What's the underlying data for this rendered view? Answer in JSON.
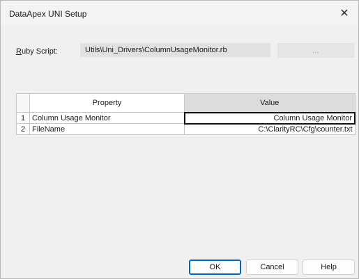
{
  "window": {
    "title": "DataApex UNI Setup",
    "close_glyph": "✕"
  },
  "script": {
    "label_first": "R",
    "label_rest": "uby Script:",
    "value": "Utils\\Uni_Drivers\\ColumnUsageMonitor.rb",
    "browse_label": "..."
  },
  "grid": {
    "headers": {
      "property": "Property",
      "value": "Value"
    },
    "rows": [
      {
        "num": "1",
        "property": "Column Usage Monitor",
        "value": "Column Usage Monitor"
      },
      {
        "num": "2",
        "property": "FileName",
        "value": "C:\\ClarityRC\\Cfg\\counter.txt"
      }
    ]
  },
  "buttons": {
    "ok": "OK",
    "cancel": "Cancel",
    "help": "Help"
  },
  "colors": {
    "accent": "#0067c0",
    "selected_header": "#dcdcdc",
    "field_bg": "#e1e1e1"
  }
}
